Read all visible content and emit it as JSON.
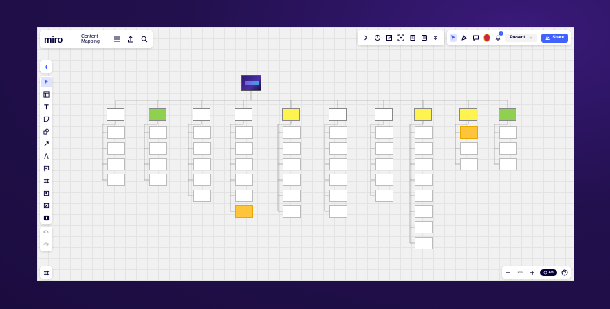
{
  "app": {
    "logo": "miro",
    "board_title": "Content Mapping"
  },
  "toolbar_right": {
    "present_label": "Present",
    "share_label": "Share",
    "notification_count": "1"
  },
  "zoom": {
    "level": "4%",
    "pages": "4/8"
  },
  "colors": {
    "accent": "#4262ff",
    "green_sticky": "#8fd14f",
    "yellow_sticky": "#fff34f",
    "orange_sticky": "#ffc53a",
    "background": "#22104e"
  },
  "diagram": {
    "columns": [
      {
        "color": "white",
        "children": [
          "white",
          "white",
          "white",
          "white"
        ]
      },
      {
        "color": "green",
        "children": [
          "white",
          "white",
          "white",
          "white"
        ]
      },
      {
        "color": "white",
        "children": [
          "white",
          "white",
          "white",
          "white",
          "white"
        ]
      },
      {
        "color": "white",
        "children": [
          "white",
          "white",
          "white",
          "white",
          "white",
          "orange"
        ]
      },
      {
        "color": "yellow",
        "children": [
          "white",
          "white",
          "white",
          "white",
          "white",
          "white"
        ]
      },
      {
        "color": "white",
        "children": [
          "white",
          "white",
          "white",
          "white",
          "white",
          "white"
        ]
      },
      {
        "color": "white",
        "children": [
          "white",
          "white",
          "white",
          "white",
          "white"
        ]
      },
      {
        "color": "yellow",
        "children": [
          "white",
          "white",
          "white",
          "white",
          "white",
          "white",
          "white",
          "white"
        ]
      },
      {
        "color": "yellow",
        "children": [
          "orange",
          "white",
          "white"
        ]
      },
      {
        "color": "green",
        "children": [
          "white",
          "white",
          "white"
        ]
      }
    ]
  }
}
